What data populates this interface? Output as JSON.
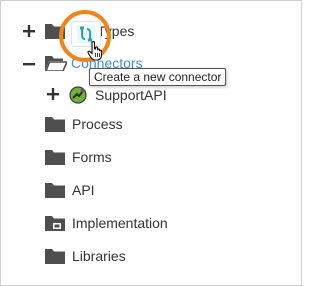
{
  "tree": {
    "items": [
      {
        "label": "Types",
        "expander": "+",
        "icon": "folder-icon"
      },
      {
        "label": "Connectors",
        "expander": "−",
        "icon": "folder-open-icon"
      },
      {
        "label": "SupportAPI",
        "expander": "+",
        "icon": "connector-plugin-icon"
      },
      {
        "label": "Process",
        "icon": "folder-icon"
      },
      {
        "label": "Forms",
        "icon": "folder-icon"
      },
      {
        "label": "API",
        "icon": "folder-icon"
      },
      {
        "label": "Implementation",
        "icon": "folder-implementation-icon"
      },
      {
        "label": "Libraries",
        "icon": "folder-icon"
      }
    ]
  },
  "tooltip": {
    "text": "Create a new connector"
  },
  "colors": {
    "folder": "#4f4f4f",
    "connectors_label": "#3f8fcf",
    "highlight_ring": "#f08419",
    "toolbar_icon": "#2aa6a6"
  }
}
